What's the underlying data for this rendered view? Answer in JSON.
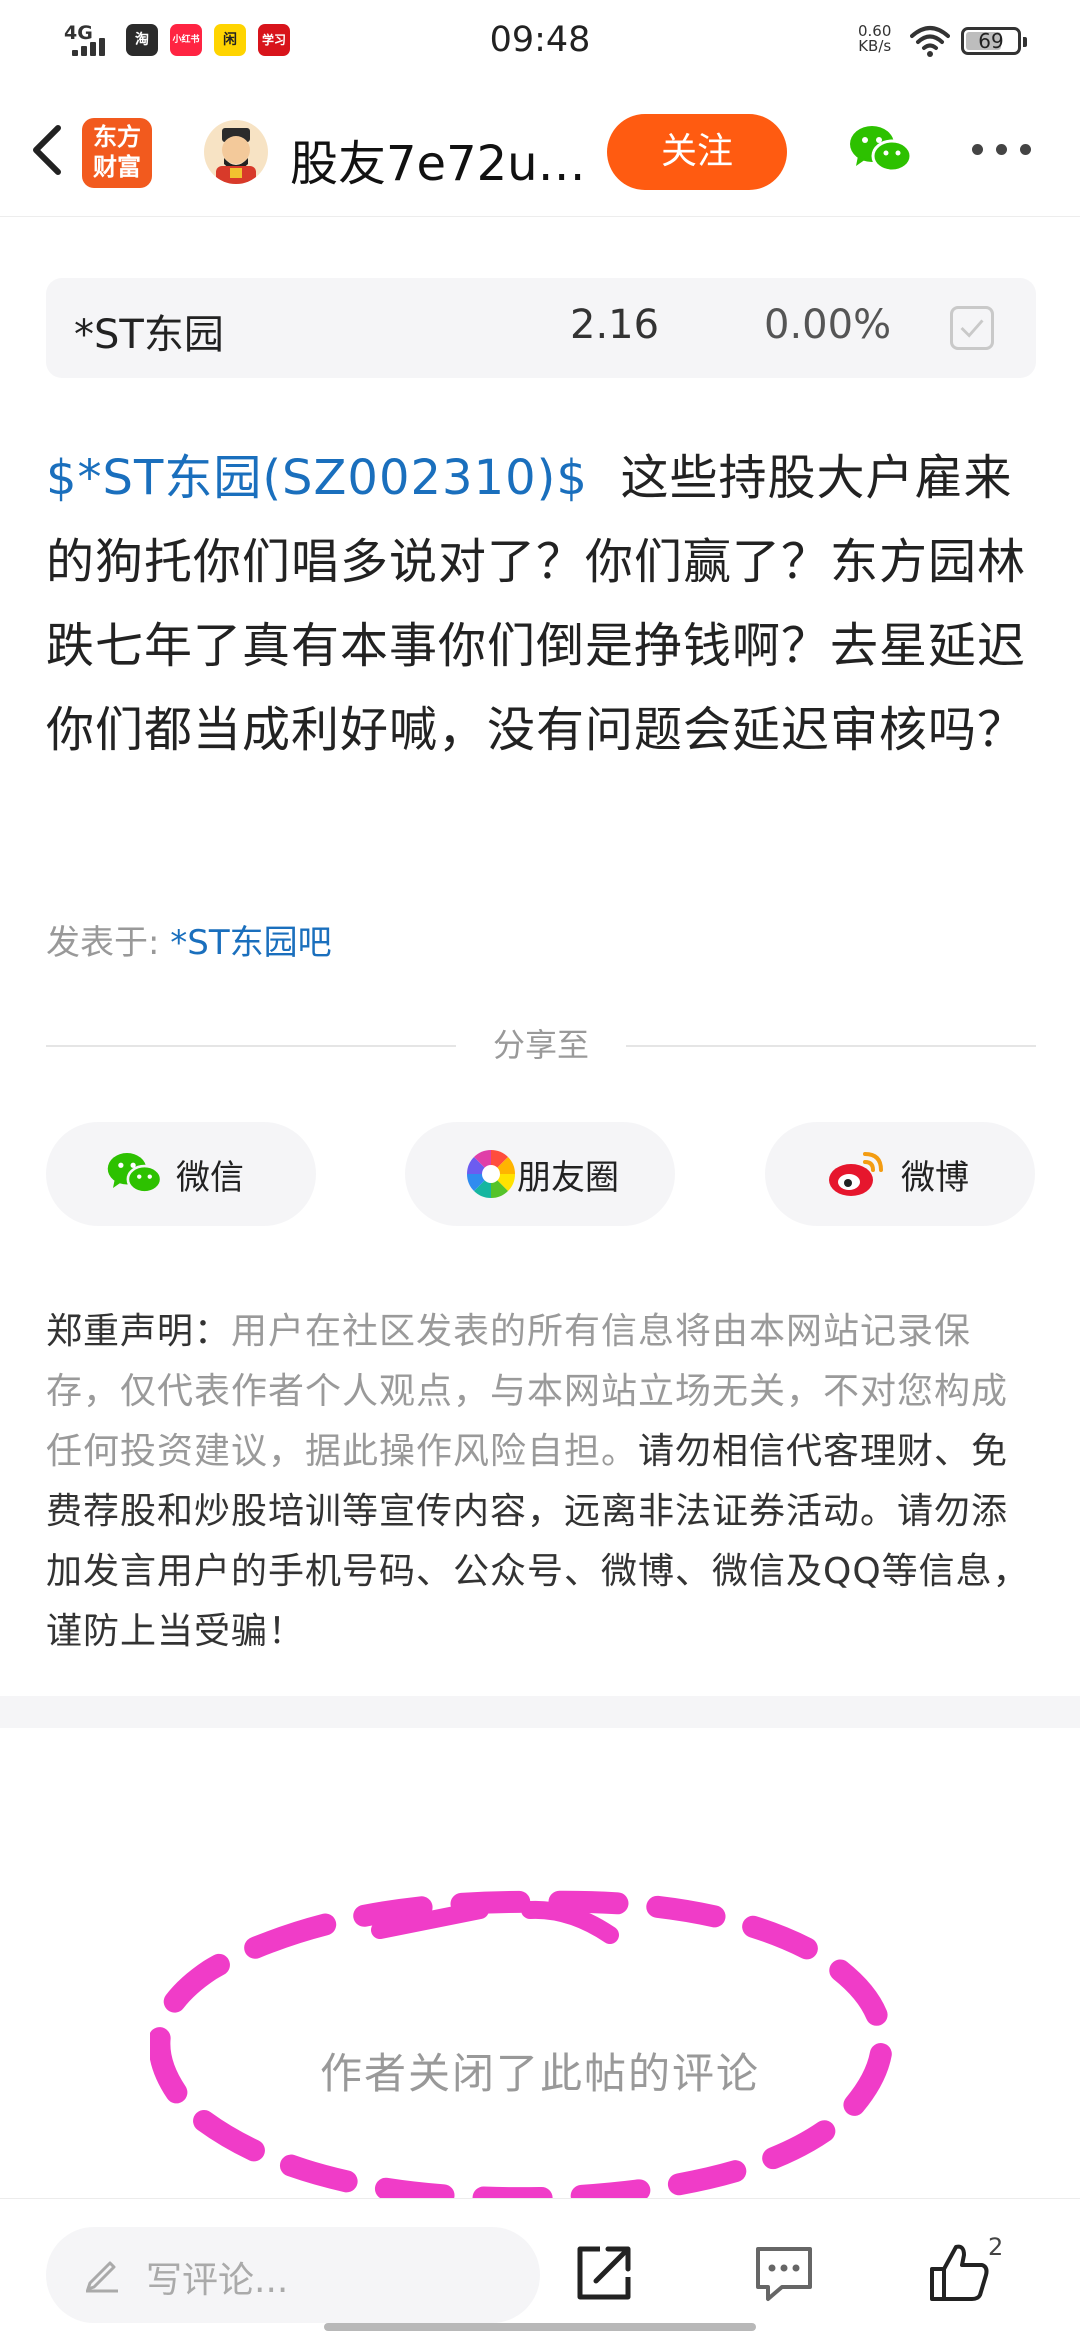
{
  "status_bar": {
    "network": "4G",
    "time": "09:48",
    "speed_value": "0.60",
    "speed_unit": "KB/s",
    "battery": "69",
    "app_icons": [
      {
        "label": "淘",
        "color": "#2b2b2b"
      },
      {
        "label": "小红书",
        "color": "#ff2442"
      },
      {
        "label": "闲",
        "color": "#ffd400"
      },
      {
        "label": "学习",
        "color": "#d8141b"
      }
    ]
  },
  "nav": {
    "logo_text_line1": "东方",
    "logo_text_line2": "财富",
    "title": "股友7e72u…",
    "follow_label": "关注"
  },
  "stock": {
    "name": "*ST东园",
    "price": "2.16",
    "change": "0.00%"
  },
  "post": {
    "tag": "$*ST东园(SZ002310)$",
    "body": "这些持股大户雇来的狗托你们唱多说对了？你们赢了？东方园林跌七年了真有本事你们倒是挣钱啊？去星延迟你们都当成利好喊，没有问题会延迟审核吗？",
    "posted_label": "发表于: ",
    "posted_bar": "*ST东园吧"
  },
  "share": {
    "heading": "分享至",
    "wechat": "微信",
    "moments": "朋友圈",
    "weibo": "微博"
  },
  "notice": {
    "title": "郑重声明：",
    "gray_text": "用户在社区发表的所有信息将由本网站记录保存，仅代表作者个人观点，与本网站立场无关，不对您构成任何投资建议，据此操作风险自担。",
    "warning_text": "请勿相信代客理财、免费荐股和炒股培训等宣传内容，远离非法证券活动。请勿添加发言用户的手机号码、公众号、微博、微信及QQ等信息，谨防上当受骗！"
  },
  "comments": {
    "closed_text": "作者关闭了此帖的评论"
  },
  "bottom_bar": {
    "comment_placeholder": "写评论...",
    "like_count": "2"
  },
  "colors": {
    "accent": "#ff5b11",
    "link": "#1a6fbd",
    "annotation": "#f03cc8"
  }
}
